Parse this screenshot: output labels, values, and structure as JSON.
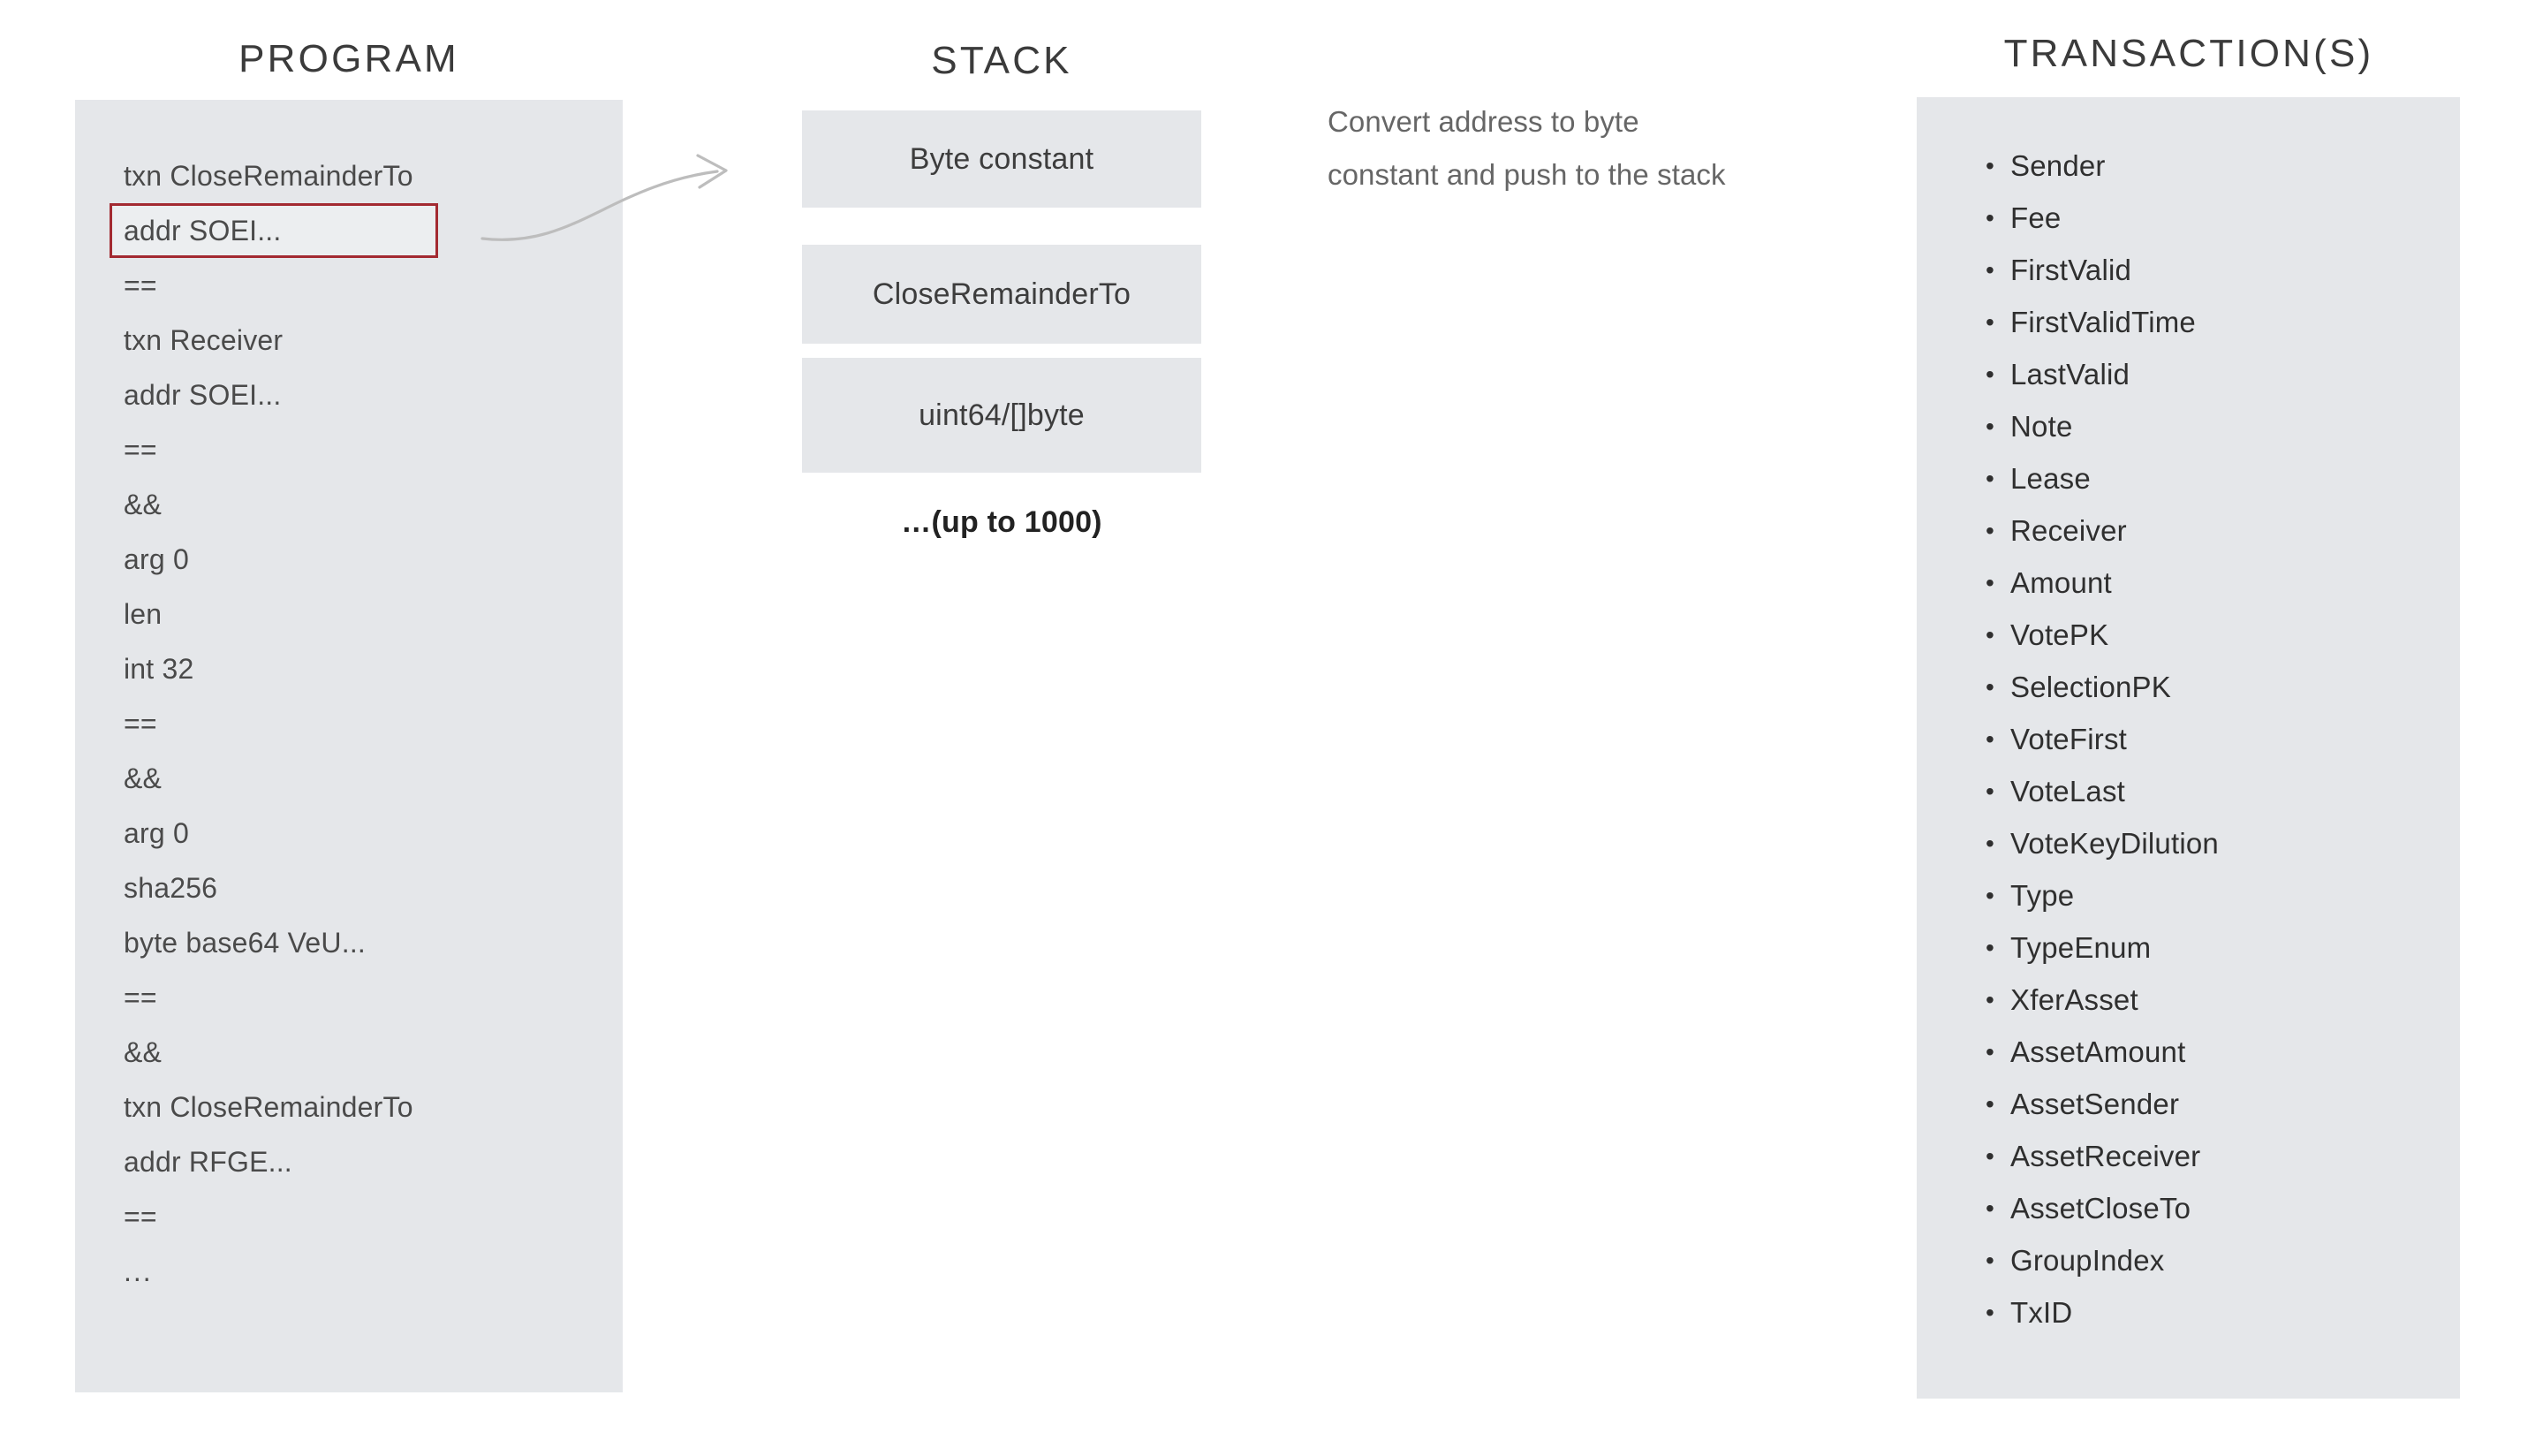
{
  "columns": {
    "program_title": "PROGRAM",
    "stack_title": "STACK",
    "transactions_title": "TRANSACTION(S)"
  },
  "program": {
    "lines": [
      {
        "text": "txn CloseRemainderTo",
        "highlighted": false
      },
      {
        "text": "addr SOEI...",
        "highlighted": true
      },
      {
        "text": "==",
        "highlighted": false
      },
      {
        "text": "txn Receiver",
        "highlighted": false
      },
      {
        "text": "addr SOEI...",
        "highlighted": false
      },
      {
        "text": "==",
        "highlighted": false
      },
      {
        "text": "&&",
        "highlighted": false
      },
      {
        "text": "arg 0",
        "highlighted": false
      },
      {
        "text": "len",
        "highlighted": false
      },
      {
        "text": "int 32",
        "highlighted": false
      },
      {
        "text": "==",
        "highlighted": false
      },
      {
        "text": "&&",
        "highlighted": false
      },
      {
        "text": "arg 0",
        "highlighted": false
      },
      {
        "text": "sha256",
        "highlighted": false
      },
      {
        "text": "byte base64 VeU...",
        "highlighted": false
      },
      {
        "text": "==",
        "highlighted": false
      },
      {
        "text": "&&",
        "highlighted": false
      },
      {
        "text": "txn CloseRemainderTo",
        "highlighted": false
      },
      {
        "text": "addr RFGE...",
        "highlighted": false
      },
      {
        "text": "==",
        "highlighted": false
      },
      {
        "text": "...",
        "highlighted": false
      }
    ]
  },
  "stack": {
    "items": [
      {
        "label": "Byte constant"
      },
      {
        "label": "CloseRemainderTo"
      },
      {
        "label": "uint64/[]byte"
      }
    ],
    "more_label": "…(up to 1000)"
  },
  "annotation": {
    "line1": "Convert address to byte",
    "line2": "constant and push to the stack"
  },
  "transactions": {
    "fields": [
      "Sender",
      "Fee",
      "FirstValid",
      "FirstValidTime",
      "LastValid",
      "Note",
      "Lease",
      "Receiver",
      "Amount",
      "VotePK",
      "SelectionPK",
      "VoteFirst",
      "VoteLast",
      "VoteKeyDilution",
      "Type",
      "TypeEnum",
      "XferAsset",
      "AssetAmount",
      "AssetSender",
      "AssetReceiver",
      "AssetCloseTo",
      "GroupIndex",
      "TxID"
    ]
  },
  "colors": {
    "panel_background": "#e5e7ea",
    "highlight_border": "#a32a31",
    "arrow": "#b8b8b8",
    "program_text": "#4a4a4a",
    "annotation_text": "#666666",
    "page_background": "#ffffff"
  }
}
